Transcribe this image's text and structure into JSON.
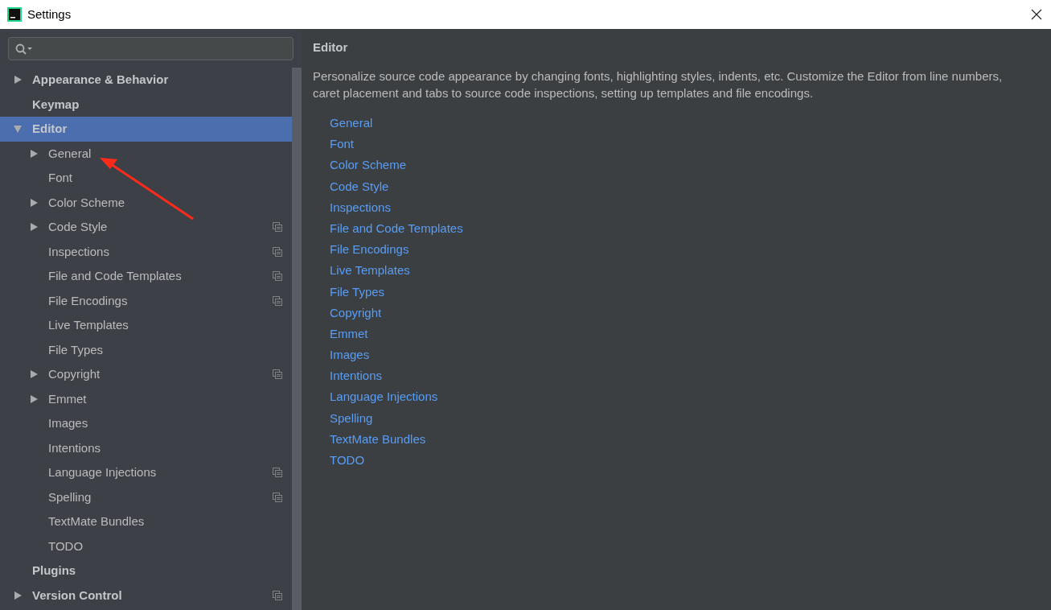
{
  "window": {
    "title": "Settings"
  },
  "tree": [
    {
      "label": "Appearance & Behavior",
      "expanded": false,
      "selected": false,
      "project_scoped": false
    },
    {
      "label": "Keymap",
      "selected": false,
      "project_scoped": false
    },
    {
      "label": "Editor",
      "expanded": true,
      "selected": true,
      "project_scoped": false,
      "children": [
        {
          "label": "General",
          "expanded": false,
          "selected": false,
          "project_scoped": false
        },
        {
          "label": "Font",
          "selected": false,
          "project_scoped": false
        },
        {
          "label": "Color Scheme",
          "expanded": false,
          "selected": false,
          "project_scoped": false
        },
        {
          "label": "Code Style",
          "expanded": false,
          "selected": false,
          "project_scoped": true
        },
        {
          "label": "Inspections",
          "selected": false,
          "project_scoped": true
        },
        {
          "label": "File and Code Templates",
          "selected": false,
          "project_scoped": true
        },
        {
          "label": "File Encodings",
          "selected": false,
          "project_scoped": true
        },
        {
          "label": "Live Templates",
          "selected": false,
          "project_scoped": false
        },
        {
          "label": "File Types",
          "selected": false,
          "project_scoped": false
        },
        {
          "label": "Copyright",
          "expanded": false,
          "selected": false,
          "project_scoped": true
        },
        {
          "label": "Emmet",
          "expanded": false,
          "selected": false,
          "project_scoped": false
        },
        {
          "label": "Images",
          "selected": false,
          "project_scoped": false
        },
        {
          "label": "Intentions",
          "selected": false,
          "project_scoped": false
        },
        {
          "label": "Language Injections",
          "selected": false,
          "project_scoped": true
        },
        {
          "label": "Spelling",
          "selected": false,
          "project_scoped": true
        },
        {
          "label": "TextMate Bundles",
          "selected": false,
          "project_scoped": false
        },
        {
          "label": "TODO",
          "selected": false,
          "project_scoped": false
        }
      ]
    },
    {
      "label": "Plugins",
      "selected": false,
      "project_scoped": false
    },
    {
      "label": "Version Control",
      "expanded": false,
      "selected": false,
      "project_scoped": true
    }
  ],
  "content": {
    "heading": "Editor",
    "description": "Personalize source code appearance by changing fonts, highlighting styles, indents, etc. Customize the Editor from line numbers, caret placement and tabs to source code inspections, setting up templates and file encodings.",
    "links": [
      "General",
      "Font",
      "Color Scheme",
      "Code Style",
      "Inspections",
      "File and Code Templates",
      "File Encodings",
      "Live Templates",
      "File Types",
      "Copyright",
      "Emmet",
      "Images",
      "Intentions",
      "Language Injections",
      "Spelling",
      "TextMate Bundles",
      "TODO"
    ]
  },
  "annotation": {
    "kind": "arrow"
  }
}
